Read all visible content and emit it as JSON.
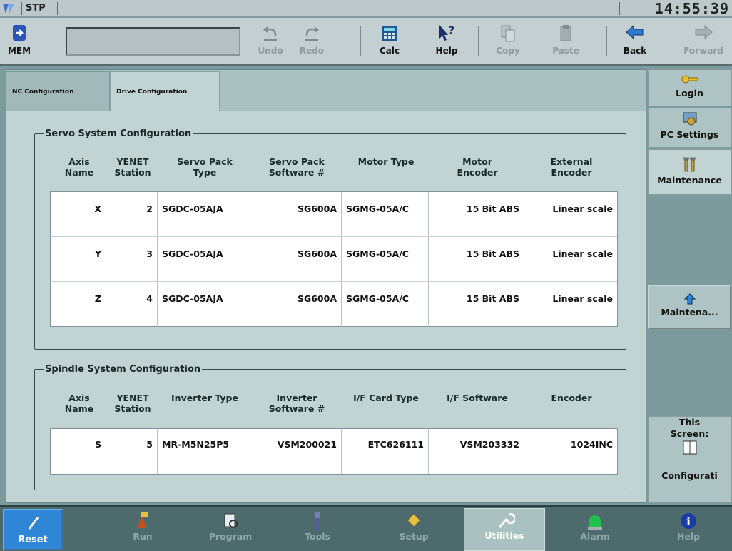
{
  "titlebar": {
    "mode": "STP",
    "clock": "14:55:39"
  },
  "toolbar": {
    "mem_label": "MEM",
    "undo": "Undo",
    "redo": "Redo",
    "calc": "Calc",
    "help": "Help",
    "copy": "Copy",
    "paste": "Paste",
    "back": "Back",
    "forward": "Forward"
  },
  "tabs": [
    {
      "label": "NC Configuration"
    },
    {
      "label": "Drive Configuration"
    }
  ],
  "servo": {
    "legend": "Servo System Configuration",
    "headers": [
      "Axis\nName",
      "YENET\nStation",
      "Servo Pack\nType",
      "Servo Pack\nSoftware #",
      "Motor Type",
      "Motor\nEncoder",
      "External\nEncoder"
    ],
    "rows": [
      [
        "X",
        "2",
        "SGDC-05AJA",
        "SG600A",
        "SGMG-05A/C",
        "15 Bit ABS",
        "Linear scale"
      ],
      [
        "Y",
        "3",
        "SGDC-05AJA",
        "SG600A",
        "SGMG-05A/C",
        "15 Bit ABS",
        "Linear scale"
      ],
      [
        "Z",
        "4",
        "SGDC-05AJA",
        "SG600A",
        "SGMG-05A/C",
        "15 Bit ABS",
        "Linear scale"
      ]
    ]
  },
  "spindle": {
    "legend": "Spindle System Configuration",
    "headers": [
      "Axis\nName",
      "YENET\nStation",
      "Inverter Type",
      "Inverter\nSoftware #",
      "I/F Card Type",
      "I/F Software",
      "Encoder"
    ],
    "rows": [
      [
        "S",
        "5",
        "MR-M5N25P5",
        "VSM200021",
        "ETC626111",
        "VSM203332",
        "1024INC"
      ]
    ]
  },
  "sidebar": {
    "login": "Login",
    "pc_settings": "PC Settings",
    "maintenance": "Maintenance",
    "mainte_btn": "Maintena...",
    "this_screen": "This Screen:",
    "configurati": "Configurati"
  },
  "footer": {
    "reset": "Reset",
    "run": "Run",
    "program": "Program",
    "tools": "Tools",
    "setup": "Setup",
    "utilities": "Utilities",
    "alarm": "Alarm",
    "help": "Help"
  },
  "colors": {
    "accent": "#2f86d6",
    "footer_active": "#a9c1c1"
  }
}
